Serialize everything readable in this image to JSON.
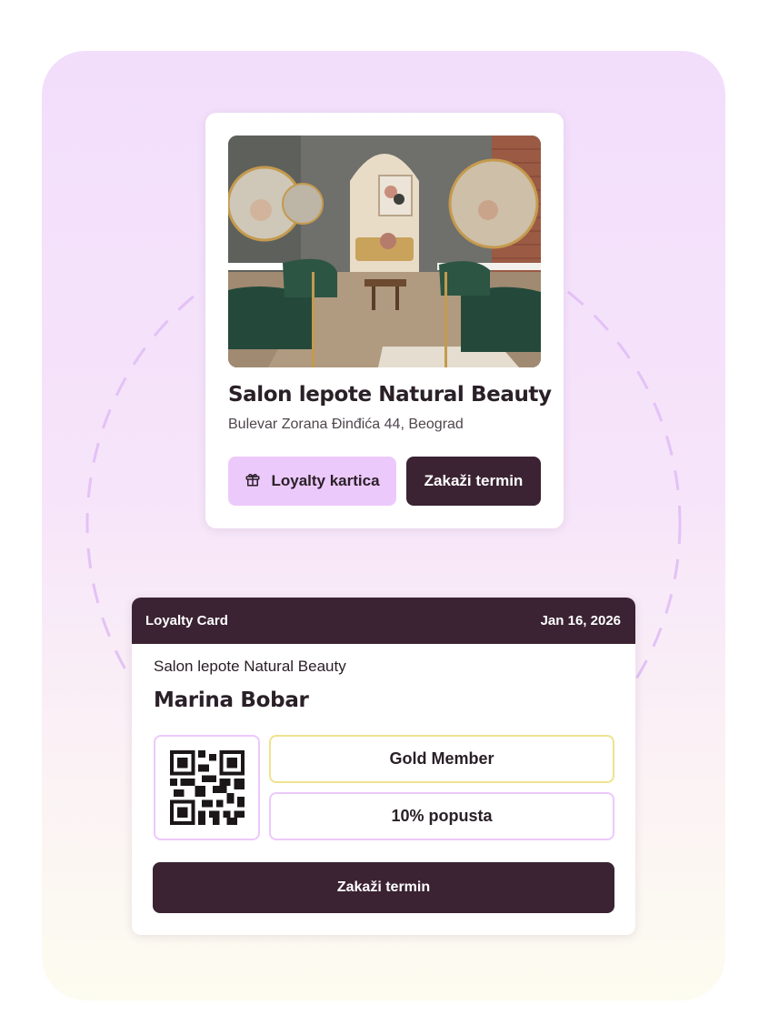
{
  "salon_card": {
    "name": "Salon lepote Natural Beauty",
    "address": "Bulevar Zorana Đinđića 44, Beograd",
    "photo_icon": "salon-interior-photo",
    "loyalty_button": {
      "label": "Loyalty kartica",
      "icon": "gift-icon"
    },
    "book_button": {
      "label": "Zakaži termin"
    }
  },
  "loyalty_card": {
    "header_title": "Loyalty Card",
    "date": "Jan 16, 2026",
    "salon_name": "Salon lepote Natural Beauty",
    "member_name": "Marina Bobar",
    "qr_icon": "qr-code-icon",
    "tier": "Gold Member",
    "discount": "10% popusta",
    "book_button": {
      "label": "Zakaži termin"
    }
  },
  "colors": {
    "primary_dark": "#3b2333",
    "accent_lilac": "#ecc9fb",
    "gold_border": "#efe38f",
    "ring_dash": "#e3c2f6"
  }
}
